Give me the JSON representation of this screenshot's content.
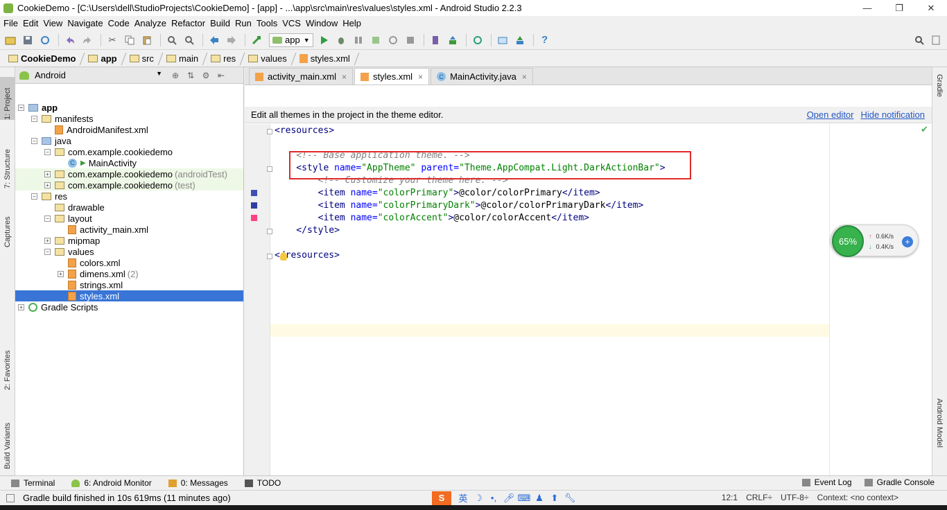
{
  "window": {
    "title": "CookieDemo - [C:\\Users\\dell\\StudioProjects\\CookieDemo] - [app] - ...\\app\\src\\main\\res\\values\\styles.xml - Android Studio 2.2.3",
    "minimize": "—",
    "maximize": "❐",
    "close": "✕"
  },
  "menu": [
    "File",
    "Edit",
    "View",
    "Navigate",
    "Code",
    "Analyze",
    "Refactor",
    "Build",
    "Run",
    "Tools",
    "VCS",
    "Window",
    "Help"
  ],
  "toolbar": {
    "run_config": "app",
    "buttons": [
      "open-icon",
      "save-icon",
      "sync-icon",
      "undo-icon",
      "redo-icon",
      "cut-icon",
      "copy-icon",
      "paste-icon",
      "find-icon",
      "replace-icon",
      "back-icon",
      "forward-icon",
      "make-icon",
      "run-icon",
      "debug-icon",
      "attach-icon",
      "apply-changes-icon",
      "stop-icon",
      "avd-icon",
      "sdk-icon",
      "structure-icon",
      "monitor-icon",
      "help-icon"
    ]
  },
  "breadcrumb": [
    "CookieDemo",
    "app",
    "src",
    "main",
    "res",
    "values",
    "styles.xml"
  ],
  "side_tabs": {
    "left": [
      "1: Project",
      "7: Structure",
      "Captures",
      "2: Favorites",
      "Build Variants"
    ],
    "right": [
      "Gradle",
      "Android Model"
    ]
  },
  "project": {
    "view": "Android",
    "tree": [
      {
        "label": "app",
        "suffix": ""
      },
      {
        "label": "manifests",
        "suffix": ""
      },
      {
        "label": "AndroidManifest.xml",
        "suffix": ""
      },
      {
        "label": "java",
        "suffix": ""
      },
      {
        "label": "com.example.cookiedemo",
        "suffix": ""
      },
      {
        "label": "MainActivity",
        "suffix": ""
      },
      {
        "label": "com.example.cookiedemo",
        "suffix": "(androidTest)"
      },
      {
        "label": "com.example.cookiedemo",
        "suffix": "(test)"
      },
      {
        "label": "res",
        "suffix": ""
      },
      {
        "label": "drawable",
        "suffix": ""
      },
      {
        "label": "layout",
        "suffix": ""
      },
      {
        "label": "activity_main.xml",
        "suffix": ""
      },
      {
        "label": "mipmap",
        "suffix": ""
      },
      {
        "label": "values",
        "suffix": ""
      },
      {
        "label": "colors.xml",
        "suffix": ""
      },
      {
        "label": "dimens.xml",
        "suffix": "(2)"
      },
      {
        "label": "strings.xml",
        "suffix": ""
      },
      {
        "label": "styles.xml",
        "suffix": ""
      },
      {
        "label": "Gradle Scripts",
        "suffix": ""
      }
    ]
  },
  "editor": {
    "tabs": [
      {
        "label": "activity_main.xml",
        "active": false
      },
      {
        "label": "styles.xml",
        "active": true
      },
      {
        "label": "MainActivity.java",
        "active": false
      }
    ],
    "notification": {
      "message": "Edit all themes in the project in the theme editor.",
      "open_editor": "Open editor",
      "hide": "Hide notification"
    },
    "colors": {
      "colorPrimary": "#3f51b5",
      "colorPrimaryDark": "#303f9f",
      "colorAccent": "#ff4081"
    }
  },
  "net_widget": {
    "percent": "65%",
    "up": "0.6K/s",
    "down": "0.4K/s"
  },
  "bottom_tabs": {
    "left": [
      "Terminal",
      "6: Android Monitor",
      "0: Messages",
      "TODO"
    ],
    "right": [
      "Event Log",
      "Gradle Console"
    ]
  },
  "status": {
    "message": "Gradle build finished in 10s 619ms (11 minutes ago)",
    "position": "12:1",
    "line_sep": "CRLF÷",
    "encoding": "UTF-8÷",
    "context": "Context: <no context>"
  }
}
